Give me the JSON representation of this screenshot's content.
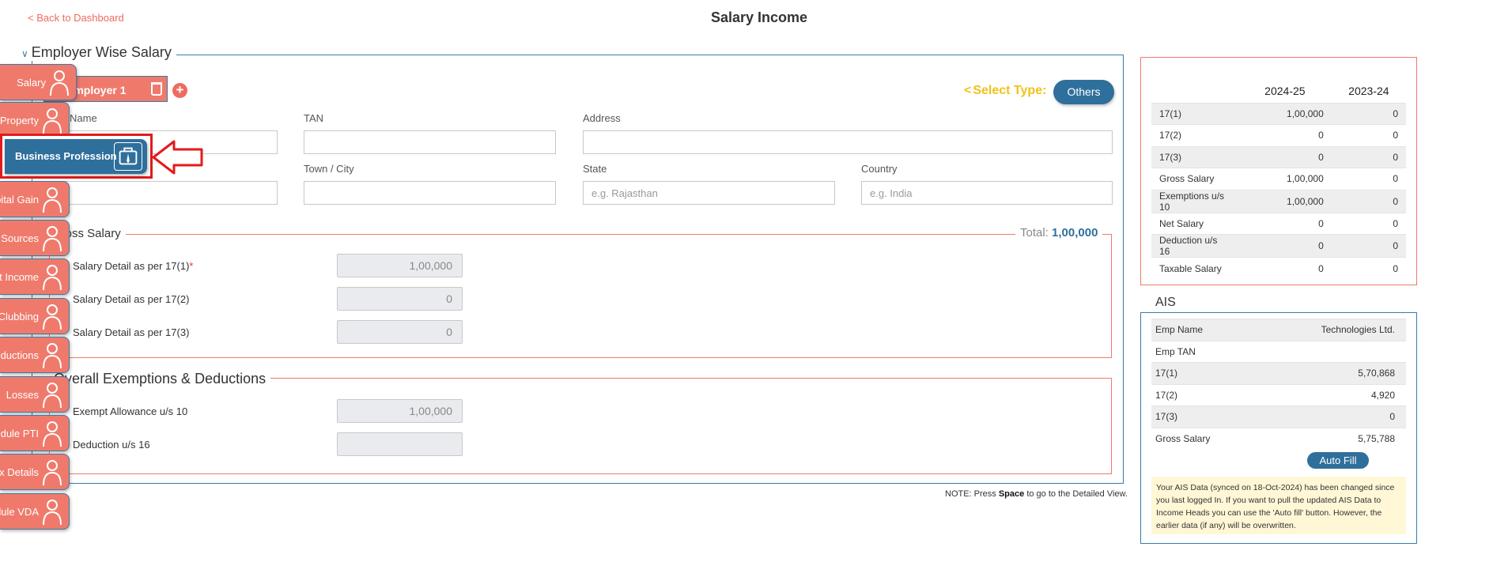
{
  "header": {
    "back_link": "< Back to Dashboard",
    "title": "Salary Income"
  },
  "employer_section": {
    "legend": "Employer Wise Salary",
    "tab_label": "Employer 1",
    "select_type_label": "Select Type:",
    "type_button": "Others",
    "fields": {
      "name_label": "Name",
      "tan_label": "TAN",
      "address_label": "Address",
      "town_label": "Town / City",
      "state_label": "State",
      "country_label": "Country",
      "state_placeholder": "e.g. Rajasthan",
      "country_placeholder": "e.g. India"
    }
  },
  "gross_salary": {
    "legend": "Gross Salary",
    "total_label": "Total:",
    "total_value": "1,00,000",
    "rows": [
      {
        "label": "Salary Detail as per 17(1)",
        "required": "*",
        "value": "1,00,000"
      },
      {
        "label": "Salary Detail as per 17(2)",
        "value": "0"
      },
      {
        "label": "Salary Detail as per 17(3)",
        "value": "0"
      }
    ]
  },
  "exemptions": {
    "legend": "Overall Exemptions & Deductions",
    "rows": [
      {
        "label": "Exempt Allowance u/s 10",
        "value": "1,00,000"
      },
      {
        "label": "Deduction u/s 16",
        "value": ""
      }
    ]
  },
  "note": {
    "prefix": "NOTE: Press ",
    "key": "Space",
    "suffix": " to go to the Detailed View."
  },
  "summary": {
    "columns": [
      "2024-25",
      "2023-24"
    ],
    "rows": [
      {
        "label": "17(1)",
        "a": "1,00,000",
        "b": "0"
      },
      {
        "label": "17(2)",
        "a": "0",
        "b": "0"
      },
      {
        "label": "17(3)",
        "a": "0",
        "b": "0"
      },
      {
        "label": "Gross Salary",
        "a": "1,00,000",
        "b": "0"
      },
      {
        "label": "Exemptions u/s 10",
        "a": "1,00,000",
        "b": "0"
      },
      {
        "label": "Net Salary",
        "a": "0",
        "b": "0"
      },
      {
        "label": "Deduction u/s 16",
        "a": "0",
        "b": "0"
      },
      {
        "label": "Taxable Salary",
        "a": "0",
        "b": "0"
      }
    ]
  },
  "ais": {
    "legend": "AIS",
    "rows": [
      {
        "label": "Emp Name",
        "value": "Technologies Ltd."
      },
      {
        "label": "Emp TAN",
        "value": ""
      },
      {
        "label": "17(1)",
        "value": "5,70,868"
      },
      {
        "label": "17(2)",
        "value": "4,920"
      },
      {
        "label": "17(3)",
        "value": "0"
      },
      {
        "label": "Gross Salary",
        "value": "5,75,788"
      }
    ],
    "autofill_button": "Auto Fill",
    "message": "Your AIS Data (synced on 18-Oct-2024) has been changed since you last logged In. If you want to pull the updated AIS Data to Income Heads you can use the 'Auto fill' button. However, the earlier data (if any) will be overwritten."
  },
  "nav": {
    "items": [
      {
        "label": "Salary",
        "icon": "person-money-icon"
      },
      {
        "label": "Property",
        "icon": "house-icon"
      },
      {
        "label": "Business Profession",
        "icon": "briefcase-icon",
        "active": "true"
      },
      {
        "label": "Capital Gain",
        "icon": "growth-chart-icon"
      },
      {
        "label": "Other Sources",
        "icon": "plant-icon"
      },
      {
        "label": "Exempt Income",
        "icon": "tax-document-icon"
      },
      {
        "label": "Clubbing",
        "icon": "people-network-icon"
      },
      {
        "label": "Deductions",
        "icon": "tax-percent-icon"
      },
      {
        "label": "Losses",
        "icon": "loss-chart-icon"
      },
      {
        "label": "Schedule PTI",
        "icon": "bank-icon"
      },
      {
        "label": "Tax Details",
        "icon": "tax-form-icon"
      },
      {
        "label": "Schedule VDA",
        "icon": "person-crypto-icon"
      }
    ]
  },
  "colors": {
    "accent_red": "#ef7a6c",
    "accent_blue": "#2f6f9c",
    "select_type_yellow": "#f2c21a",
    "highlight_border": "#e21b1b"
  }
}
